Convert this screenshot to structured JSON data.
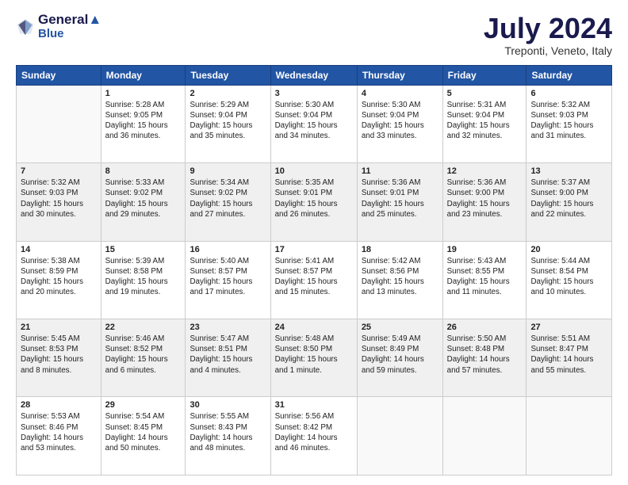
{
  "header": {
    "logo_line1": "General",
    "logo_line2": "Blue",
    "month": "July 2024",
    "location": "Treponti, Veneto, Italy"
  },
  "weekdays": [
    "Sunday",
    "Monday",
    "Tuesday",
    "Wednesday",
    "Thursday",
    "Friday",
    "Saturday"
  ],
  "weeks": [
    [
      {
        "day": "",
        "info": ""
      },
      {
        "day": "1",
        "info": "Sunrise: 5:28 AM\nSunset: 9:05 PM\nDaylight: 15 hours\nand 36 minutes."
      },
      {
        "day": "2",
        "info": "Sunrise: 5:29 AM\nSunset: 9:04 PM\nDaylight: 15 hours\nand 35 minutes."
      },
      {
        "day": "3",
        "info": "Sunrise: 5:30 AM\nSunset: 9:04 PM\nDaylight: 15 hours\nand 34 minutes."
      },
      {
        "day": "4",
        "info": "Sunrise: 5:30 AM\nSunset: 9:04 PM\nDaylight: 15 hours\nand 33 minutes."
      },
      {
        "day": "5",
        "info": "Sunrise: 5:31 AM\nSunset: 9:04 PM\nDaylight: 15 hours\nand 32 minutes."
      },
      {
        "day": "6",
        "info": "Sunrise: 5:32 AM\nSunset: 9:03 PM\nDaylight: 15 hours\nand 31 minutes."
      }
    ],
    [
      {
        "day": "7",
        "info": "Sunrise: 5:32 AM\nSunset: 9:03 PM\nDaylight: 15 hours\nand 30 minutes."
      },
      {
        "day": "8",
        "info": "Sunrise: 5:33 AM\nSunset: 9:02 PM\nDaylight: 15 hours\nand 29 minutes."
      },
      {
        "day": "9",
        "info": "Sunrise: 5:34 AM\nSunset: 9:02 PM\nDaylight: 15 hours\nand 27 minutes."
      },
      {
        "day": "10",
        "info": "Sunrise: 5:35 AM\nSunset: 9:01 PM\nDaylight: 15 hours\nand 26 minutes."
      },
      {
        "day": "11",
        "info": "Sunrise: 5:36 AM\nSunset: 9:01 PM\nDaylight: 15 hours\nand 25 minutes."
      },
      {
        "day": "12",
        "info": "Sunrise: 5:36 AM\nSunset: 9:00 PM\nDaylight: 15 hours\nand 23 minutes."
      },
      {
        "day": "13",
        "info": "Sunrise: 5:37 AM\nSunset: 9:00 PM\nDaylight: 15 hours\nand 22 minutes."
      }
    ],
    [
      {
        "day": "14",
        "info": "Sunrise: 5:38 AM\nSunset: 8:59 PM\nDaylight: 15 hours\nand 20 minutes."
      },
      {
        "day": "15",
        "info": "Sunrise: 5:39 AM\nSunset: 8:58 PM\nDaylight: 15 hours\nand 19 minutes."
      },
      {
        "day": "16",
        "info": "Sunrise: 5:40 AM\nSunset: 8:57 PM\nDaylight: 15 hours\nand 17 minutes."
      },
      {
        "day": "17",
        "info": "Sunrise: 5:41 AM\nSunset: 8:57 PM\nDaylight: 15 hours\nand 15 minutes."
      },
      {
        "day": "18",
        "info": "Sunrise: 5:42 AM\nSunset: 8:56 PM\nDaylight: 15 hours\nand 13 minutes."
      },
      {
        "day": "19",
        "info": "Sunrise: 5:43 AM\nSunset: 8:55 PM\nDaylight: 15 hours\nand 11 minutes."
      },
      {
        "day": "20",
        "info": "Sunrise: 5:44 AM\nSunset: 8:54 PM\nDaylight: 15 hours\nand 10 minutes."
      }
    ],
    [
      {
        "day": "21",
        "info": "Sunrise: 5:45 AM\nSunset: 8:53 PM\nDaylight: 15 hours\nand 8 minutes."
      },
      {
        "day": "22",
        "info": "Sunrise: 5:46 AM\nSunset: 8:52 PM\nDaylight: 15 hours\nand 6 minutes."
      },
      {
        "day": "23",
        "info": "Sunrise: 5:47 AM\nSunset: 8:51 PM\nDaylight: 15 hours\nand 4 minutes."
      },
      {
        "day": "24",
        "info": "Sunrise: 5:48 AM\nSunset: 8:50 PM\nDaylight: 15 hours\nand 1 minute."
      },
      {
        "day": "25",
        "info": "Sunrise: 5:49 AM\nSunset: 8:49 PM\nDaylight: 14 hours\nand 59 minutes."
      },
      {
        "day": "26",
        "info": "Sunrise: 5:50 AM\nSunset: 8:48 PM\nDaylight: 14 hours\nand 57 minutes."
      },
      {
        "day": "27",
        "info": "Sunrise: 5:51 AM\nSunset: 8:47 PM\nDaylight: 14 hours\nand 55 minutes."
      }
    ],
    [
      {
        "day": "28",
        "info": "Sunrise: 5:53 AM\nSunset: 8:46 PM\nDaylight: 14 hours\nand 53 minutes."
      },
      {
        "day": "29",
        "info": "Sunrise: 5:54 AM\nSunset: 8:45 PM\nDaylight: 14 hours\nand 50 minutes."
      },
      {
        "day": "30",
        "info": "Sunrise: 5:55 AM\nSunset: 8:43 PM\nDaylight: 14 hours\nand 48 minutes."
      },
      {
        "day": "31",
        "info": "Sunrise: 5:56 AM\nSunset: 8:42 PM\nDaylight: 14 hours\nand 46 minutes."
      },
      {
        "day": "",
        "info": ""
      },
      {
        "day": "",
        "info": ""
      },
      {
        "day": "",
        "info": ""
      }
    ]
  ]
}
